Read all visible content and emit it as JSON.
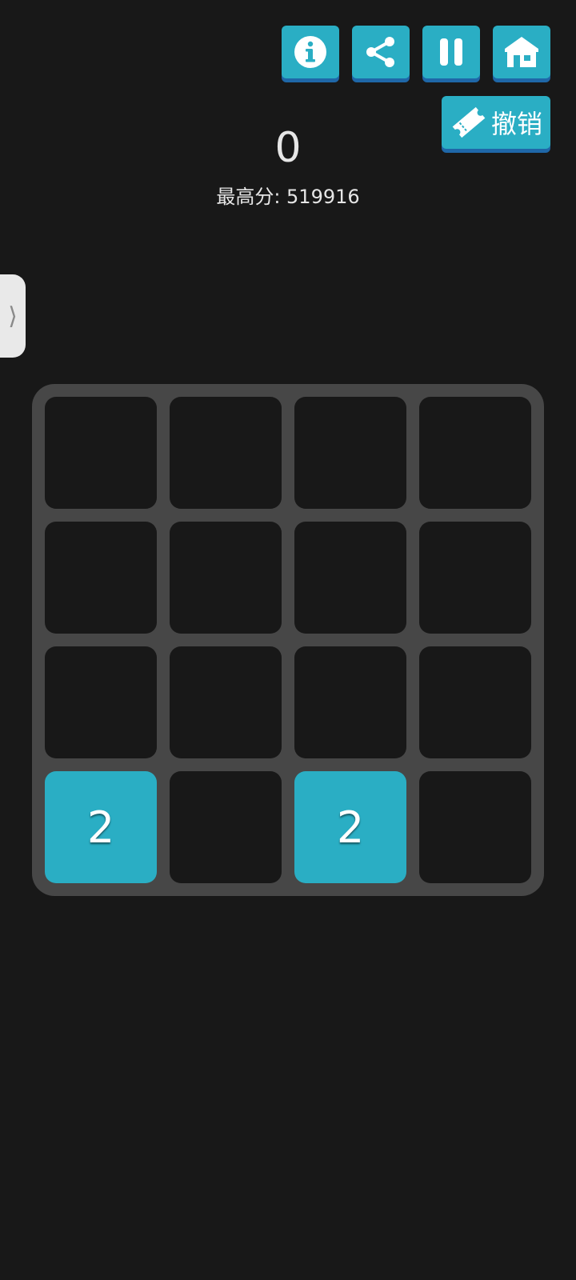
{
  "score": "0",
  "best_score_text": "最高分:  519916",
  "undo_label": "撤销",
  "icons": {
    "info": "info-icon",
    "share": "share-icon",
    "pause": "pause-icon",
    "home": "home-icon",
    "undo": "ticket-icon",
    "side_tab": "chevron-right-icon"
  },
  "side_tab_glyph": "⟩",
  "colors": {
    "background": "#181818",
    "accent": "#2aaec4",
    "accent_shadow": "#1f67a8",
    "board": "#474747",
    "tile_2": "#2aaec4"
  },
  "board": [
    [
      "",
      "",
      "",
      ""
    ],
    [
      "",
      "",
      "",
      ""
    ],
    [
      "",
      "",
      "",
      ""
    ],
    [
      "2",
      "",
      "2",
      ""
    ]
  ]
}
